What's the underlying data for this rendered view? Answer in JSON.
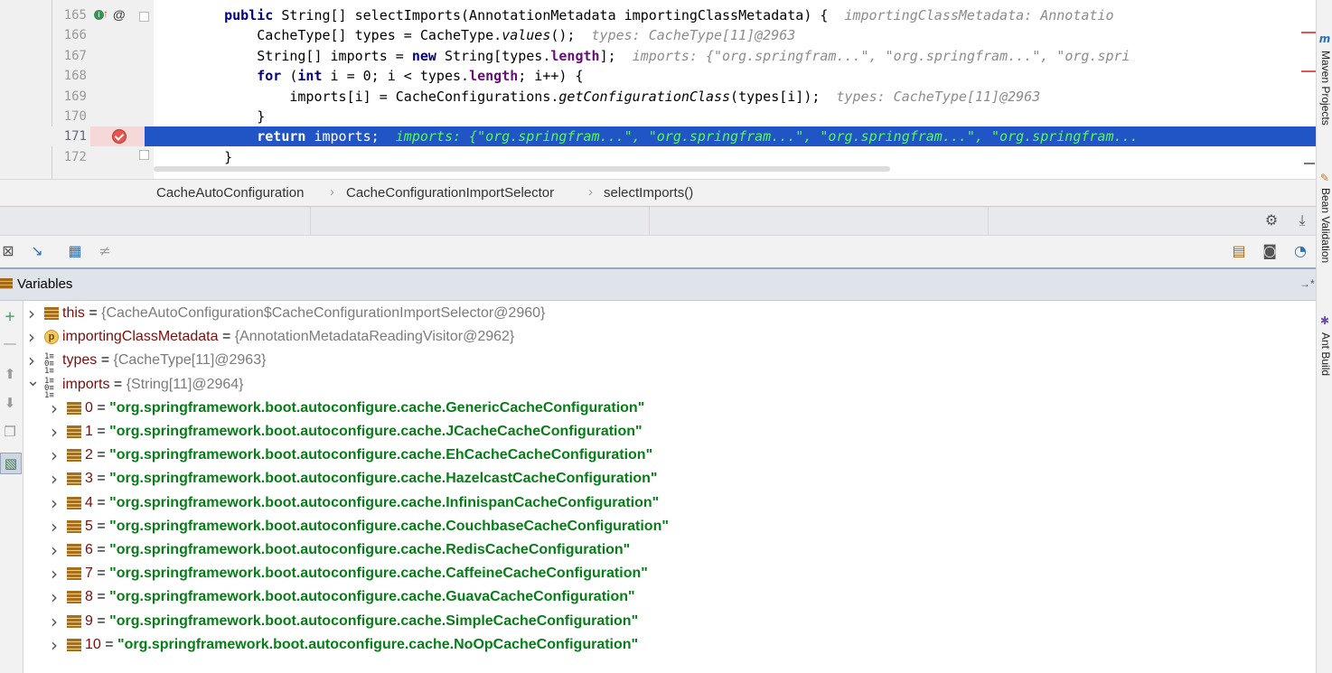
{
  "editor": {
    "lines": [
      {
        "num": "165",
        "indent": "    ",
        "tokens": [
          {
            "t": "public ",
            "c": "kw"
          },
          {
            "t": "String[] selectImports(AnnotationMetadata importingClassMetadata) {",
            "c": ""
          },
          {
            "t": "  importingClassMetadata: Annotatio",
            "c": "hint"
          }
        ]
      },
      {
        "num": "166",
        "indent": "        ",
        "tokens": [
          {
            "t": "CacheType[] types = CacheType.",
            "c": ""
          },
          {
            "t": "values",
            "c": "it"
          },
          {
            "t": "();",
            "c": ""
          },
          {
            "t": "  types: CacheType[11]@2963",
            "c": "hint"
          }
        ]
      },
      {
        "num": "167",
        "indent": "        ",
        "tokens": [
          {
            "t": "String[] imports = ",
            "c": ""
          },
          {
            "t": "new ",
            "c": "kw"
          },
          {
            "t": "String[types.",
            "c": ""
          },
          {
            "t": "length",
            "c": "fld"
          },
          {
            "t": "];",
            "c": ""
          },
          {
            "t": "  imports: {\"org.springfram...\", \"org.springfram...\", \"org.spri",
            "c": "hint"
          }
        ]
      },
      {
        "num": "168",
        "indent": "        ",
        "tokens": [
          {
            "t": "for ",
            "c": "kw"
          },
          {
            "t": "(",
            "c": ""
          },
          {
            "t": "int ",
            "c": "kw"
          },
          {
            "t": "i = 0; i < types.",
            "c": ""
          },
          {
            "t": "length",
            "c": "fld"
          },
          {
            "t": "; i++) {",
            "c": ""
          }
        ]
      },
      {
        "num": "169",
        "indent": "            ",
        "tokens": [
          {
            "t": "imports[i] = CacheConfigurations.",
            "c": ""
          },
          {
            "t": "getConfigurationClass",
            "c": "it"
          },
          {
            "t": "(types[i]);",
            "c": ""
          },
          {
            "t": "  types: CacheType[11]@2963",
            "c": "hint"
          }
        ]
      },
      {
        "num": "170",
        "indent": "        ",
        "tokens": [
          {
            "t": "}",
            "c": ""
          }
        ]
      },
      {
        "num": "171",
        "indent": "        ",
        "highlight": true,
        "tokens": [
          {
            "t": "return ",
            "c": "kw"
          },
          {
            "t": "imports;",
            "c": ""
          },
          {
            "t": "  imports: {\"org.springfram...\", \"org.springfram...\", \"org.springfram...\", \"org.springfram...",
            "c": "hint"
          }
        ]
      },
      {
        "num": "172",
        "indent": "    ",
        "tokens": [
          {
            "t": "}",
            "c": ""
          }
        ]
      }
    ],
    "at_icon": "@"
  },
  "breadcrumb": {
    "items": [
      "CacheAutoConfiguration",
      "CacheConfigurationImportSelector",
      "selectImports()"
    ],
    "sep": "›"
  },
  "debugger": {
    "title": "Variables",
    "pin": "→*"
  },
  "variables": {
    "top": [
      {
        "name": "this",
        "eq": " = ",
        "value": "{CacheAutoConfiguration$CacheConfigurationImportSelector@2960}",
        "icon": "object-icon",
        "open": false
      },
      {
        "name": "importingClassMetadata",
        "eq": " = ",
        "value": "{AnnotationMetadataReadingVisitor@2962}",
        "icon": "parameter-icon",
        "open": false
      },
      {
        "name": "types",
        "eq": " = ",
        "value": "{CacheType[11]@2963}",
        "icon": "array-icon",
        "open": false
      },
      {
        "name": "imports",
        "eq": " = ",
        "value": "{String[11]@2964}",
        "icon": "array-icon",
        "open": true
      }
    ],
    "p_letter": "p",
    "children": [
      {
        "name": "0",
        "eq": " = ",
        "value": "\"org.springframework.boot.autoconfigure.cache.GenericCacheConfiguration\""
      },
      {
        "name": "1",
        "eq": " = ",
        "value": "\"org.springframework.boot.autoconfigure.cache.JCacheCacheConfiguration\""
      },
      {
        "name": "2",
        "eq": " = ",
        "value": "\"org.springframework.boot.autoconfigure.cache.EhCacheCacheConfiguration\""
      },
      {
        "name": "3",
        "eq": " = ",
        "value": "\"org.springframework.boot.autoconfigure.cache.HazelcastCacheConfiguration\""
      },
      {
        "name": "4",
        "eq": " = ",
        "value": "\"org.springframework.boot.autoconfigure.cache.InfinispanCacheConfiguration\""
      },
      {
        "name": "5",
        "eq": " = ",
        "value": "\"org.springframework.boot.autoconfigure.cache.CouchbaseCacheConfiguration\""
      },
      {
        "name": "6",
        "eq": " = ",
        "value": "\"org.springframework.boot.autoconfigure.cache.RedisCacheConfiguration\""
      },
      {
        "name": "7",
        "eq": " = ",
        "value": "\"org.springframework.boot.autoconfigure.cache.CaffeineCacheConfiguration\""
      },
      {
        "name": "8",
        "eq": " = ",
        "value": "\"org.springframework.boot.autoconfigure.cache.GuavaCacheConfiguration\""
      },
      {
        "name": "9",
        "eq": " = ",
        "value": "\"org.springframework.boot.autoconfigure.cache.SimpleCacheConfiguration\""
      },
      {
        "name": "10",
        "eq": " = ",
        "value": "\"org.springframework.boot.autoconfigure.cache.NoOpCacheConfiguration\""
      }
    ]
  },
  "right_strip": {
    "items": [
      "Maven Projects",
      "Bean Validation",
      "Ant Build"
    ],
    "maven_letter": "m"
  },
  "colors": {
    "selection": "#2155c5",
    "keyword": "#000080",
    "string_value": "#067d17",
    "hint_on_selection": "#59f759"
  }
}
